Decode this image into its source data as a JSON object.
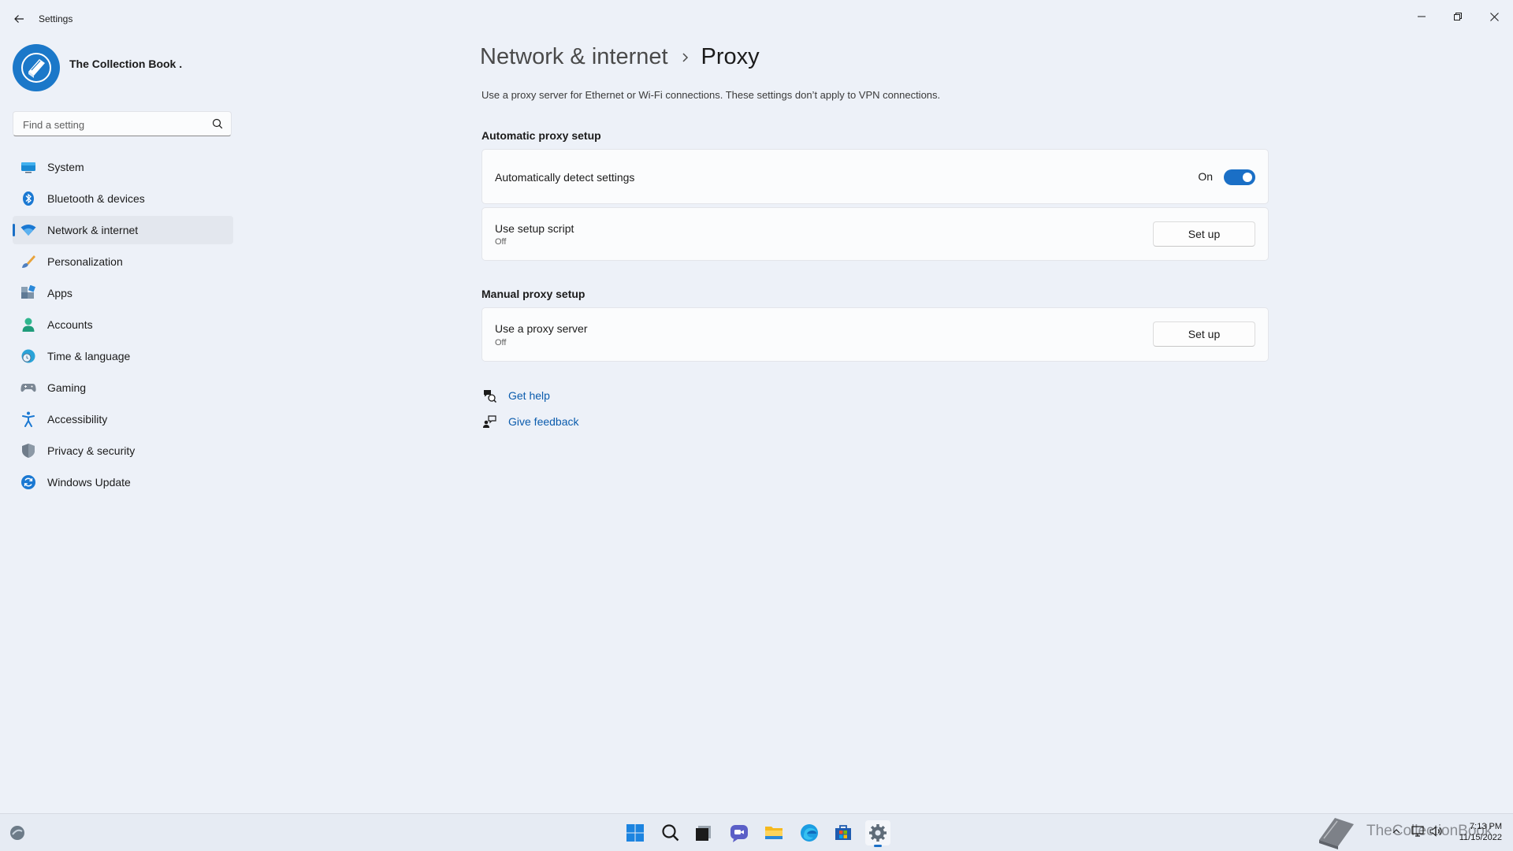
{
  "window": {
    "title": "Settings"
  },
  "profile": {
    "name": "The Collection Book ."
  },
  "search": {
    "placeholder": "Find a setting"
  },
  "sidebar": {
    "items": [
      {
        "label": "System",
        "icon": "system-icon"
      },
      {
        "label": "Bluetooth & devices",
        "icon": "bluetooth-icon"
      },
      {
        "label": "Network & internet",
        "icon": "wifi-icon",
        "active": true
      },
      {
        "label": "Personalization",
        "icon": "brush-icon"
      },
      {
        "label": "Apps",
        "icon": "apps-icon"
      },
      {
        "label": "Accounts",
        "icon": "account-icon"
      },
      {
        "label": "Time & language",
        "icon": "globe-clock-icon"
      },
      {
        "label": "Gaming",
        "icon": "gamepad-icon"
      },
      {
        "label": "Accessibility",
        "icon": "accessibility-icon"
      },
      {
        "label": "Privacy & security",
        "icon": "shield-icon"
      },
      {
        "label": "Windows Update",
        "icon": "update-icon"
      }
    ]
  },
  "breadcrumb": {
    "parent": "Network & internet",
    "current": "Proxy"
  },
  "main": {
    "description": "Use a proxy server for Ethernet or Wi-Fi connections. These settings don’t apply to VPN connections.",
    "automatic": {
      "title": "Automatic proxy setup",
      "detect": {
        "label": "Automatically detect settings",
        "state": "On",
        "enabled": true
      },
      "script": {
        "label": "Use setup script",
        "status": "Off",
        "button": "Set up"
      }
    },
    "manual": {
      "title": "Manual proxy setup",
      "proxy": {
        "label": "Use a proxy server",
        "status": "Off",
        "button": "Set up"
      }
    },
    "help": {
      "get_help": "Get help",
      "feedback": "Give feedback"
    }
  },
  "taskbar": {
    "icons": [
      "widgets-icon",
      "start-icon",
      "search-icon",
      "task-view-icon",
      "chat-icon",
      "file-explorer-icon",
      "edge-icon",
      "store-icon",
      "settings-icon"
    ],
    "watermark": "TheCollectionBook",
    "clock": {
      "time": "7:13 PM",
      "date": "11/15/2022"
    }
  },
  "colors": {
    "accent": "#1a6fc6",
    "link": "#0b5cad",
    "background": "#edf1f8"
  }
}
